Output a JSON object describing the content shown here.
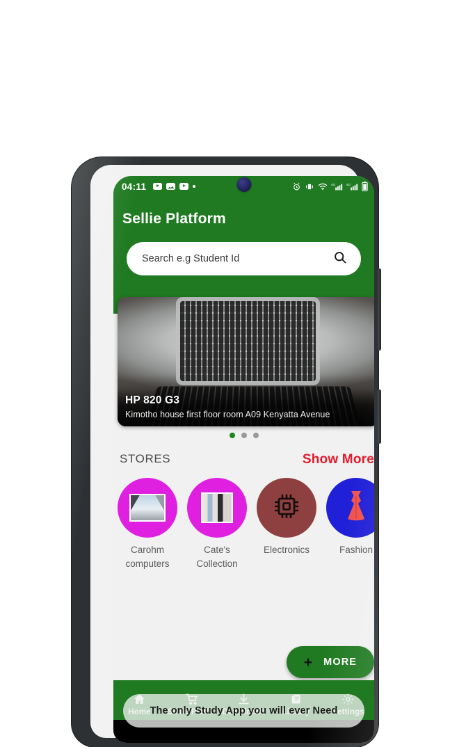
{
  "status_bar": {
    "time": "04:11",
    "left_icons": [
      "youtube-icon",
      "image-icon",
      "youtube-icon",
      "dot-icon"
    ],
    "right_icons": [
      "alarm-icon",
      "vibrate-icon",
      "wifi-icon",
      "signal-4g-icon",
      "signal-4g-icon",
      "battery-icon"
    ],
    "network_label": "4G"
  },
  "header": {
    "title": "Sellie Platform",
    "background_color": "#1f7a21"
  },
  "search": {
    "placeholder": "Search e.g Student Id",
    "value": "",
    "icon": "search-icon"
  },
  "carousel": {
    "title": "HP 820 G3",
    "subtitle": "Kimotho house first floor room A09 Kenyatta Avenue",
    "image": "laptop-photo",
    "dots": [
      {
        "active": true
      },
      {
        "active": false
      },
      {
        "active": false
      }
    ],
    "active_dot_color": "#188a1b"
  },
  "stores_section": {
    "label": "STORES",
    "show_more_label": "Show More",
    "show_more_color": "#e3192b",
    "items": [
      {
        "label": "Carohm computers",
        "circle_color": "#e020e0",
        "icon": "laptops-photo-icon",
        "wrap": true
      },
      {
        "label": "Cate's Collection",
        "circle_color": "#e020e0",
        "icon": "clothes-photo-icon",
        "wrap": true
      },
      {
        "label": "Electronics",
        "circle_color": "#8e4040",
        "icon": "microchip-icon",
        "wrap": false
      },
      {
        "label": "Fashion",
        "circle_color": "#2020d8",
        "icon": "dress-icon",
        "wrap": false
      }
    ]
  },
  "fab": {
    "plus": "+",
    "label": "MORE",
    "color": "#1f7a21"
  },
  "promo_banner": {
    "text": "The only Study App you will ever Need"
  },
  "bottom_nav": {
    "items": [
      {
        "label": "Home",
        "icon": "home-icon"
      },
      {
        "label": "Sellie Platf...",
        "icon": "cart-icon"
      },
      {
        "label": "Downloads",
        "icon": "download-icon"
      },
      {
        "label": "Library",
        "icon": "document-icon"
      },
      {
        "label": "Settings",
        "icon": "gear-icon"
      }
    ]
  }
}
